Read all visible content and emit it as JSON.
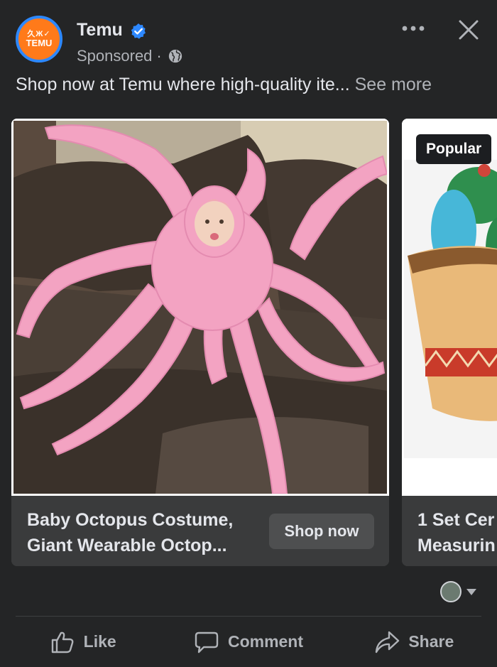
{
  "post": {
    "page_name": "Temu",
    "sponsored": "Sponsored",
    "dot": "·",
    "caption": "Shop now at Temu where high-quality ite...",
    "see_more": "See more",
    "avatar_brand": "TEMU",
    "avatar_glyphs": "久Ж✓",
    "icons": {
      "verified": "verified-badge-icon",
      "audience": "globe-icon",
      "more": "more-options-icon",
      "close": "close-icon"
    }
  },
  "carousel": {
    "cards": [
      {
        "title": "Baby Octopus Costume, Giant Wearable Octop...",
        "cta": "Shop now",
        "image": "product photo of baby in pink octopus costume on a leather sofa"
      },
      {
        "badge": "Popular",
        "title": "1 Set Cer Measurin",
        "title_line1": "1 Set Cer",
        "title_line2": "Measurin",
        "image": "product photo of cactus measuring spoons in a pot"
      }
    ]
  },
  "actions": {
    "like": "Like",
    "comment": "Comment",
    "share": "Share"
  },
  "colors": {
    "background": "#242526",
    "card": "#3a3b3c",
    "text_primary": "#e4e6eb",
    "text_secondary": "#b0b3b8",
    "verified": "#2d88ff",
    "brand": "#ff7a1a"
  }
}
